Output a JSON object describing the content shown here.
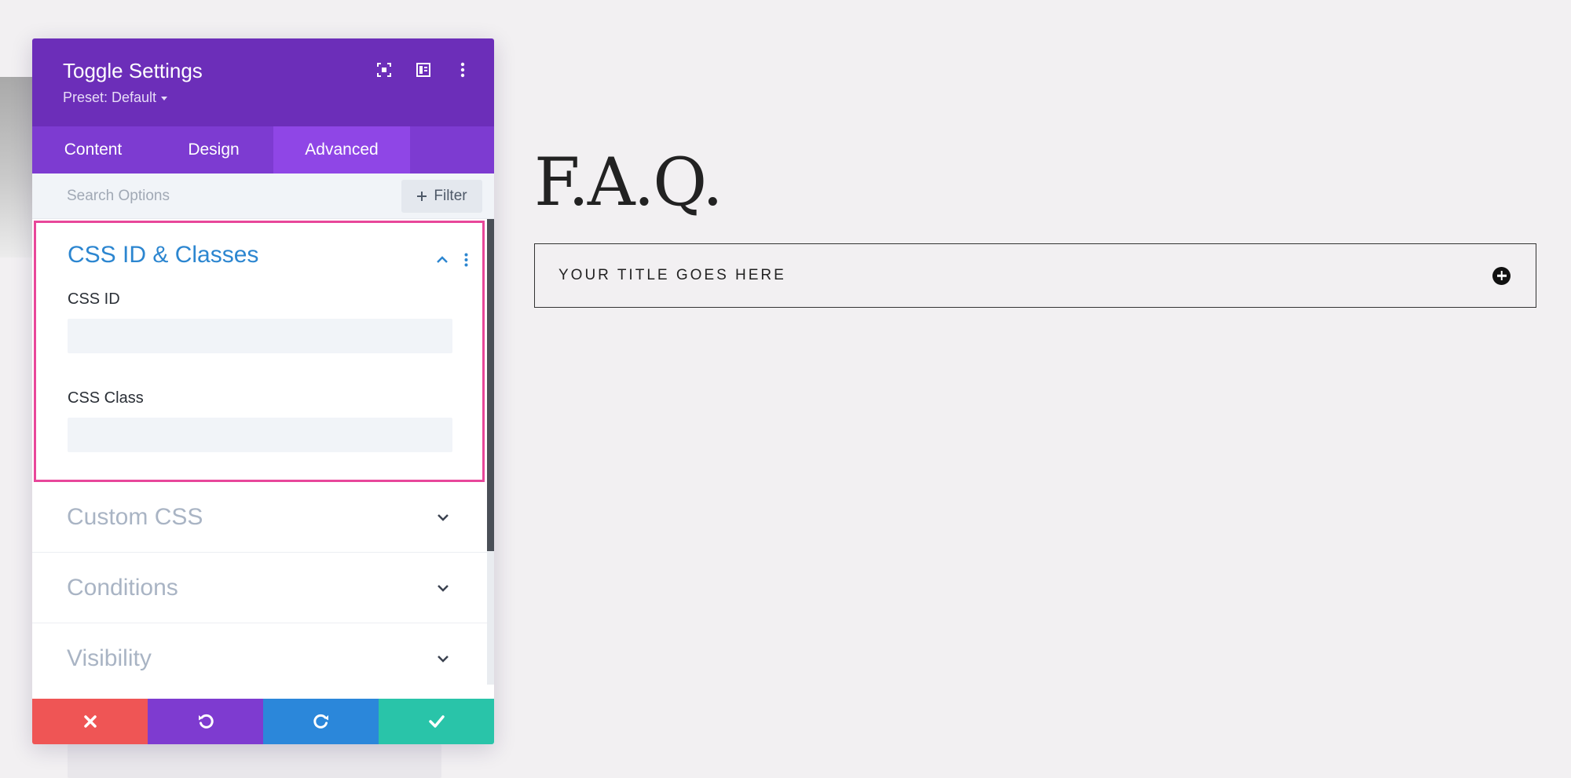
{
  "modal": {
    "title": "Toggle Settings",
    "preset_label": "Preset: Default",
    "header_icons": [
      "expand-icon",
      "sidebar-layout-icon",
      "more-vertical-icon"
    ],
    "tabs": [
      {
        "label": "Content",
        "active": false
      },
      {
        "label": "Design",
        "active": false
      },
      {
        "label": "Advanced",
        "active": true
      }
    ],
    "search": {
      "placeholder": "Search Options",
      "value": ""
    },
    "filter_label": "Filter",
    "open_section": {
      "title": "CSS ID & Classes",
      "fields": [
        {
          "label": "CSS ID",
          "value": ""
        },
        {
          "label": "CSS Class",
          "value": ""
        }
      ]
    },
    "collapsed_sections": [
      "Custom CSS",
      "Conditions",
      "Visibility"
    ],
    "footer_buttons": [
      "cancel-icon",
      "undo-icon",
      "redo-icon",
      "save-check-icon"
    ]
  },
  "page": {
    "faq_title": "F.A.Q.",
    "toggle_title": "YOUR TITLE GOES HERE"
  },
  "colors": {
    "header_purple": "#6c2eb9",
    "tab_purple": "#7d3bd1",
    "active_tab": "#8f46e6",
    "section_title_blue": "#2c86d0",
    "highlight_pink": "#e8479a",
    "cancel_red": "#ef5555",
    "undo_purple": "#7e3bd0",
    "redo_blue": "#2b87da",
    "save_green": "#29c4a9"
  }
}
